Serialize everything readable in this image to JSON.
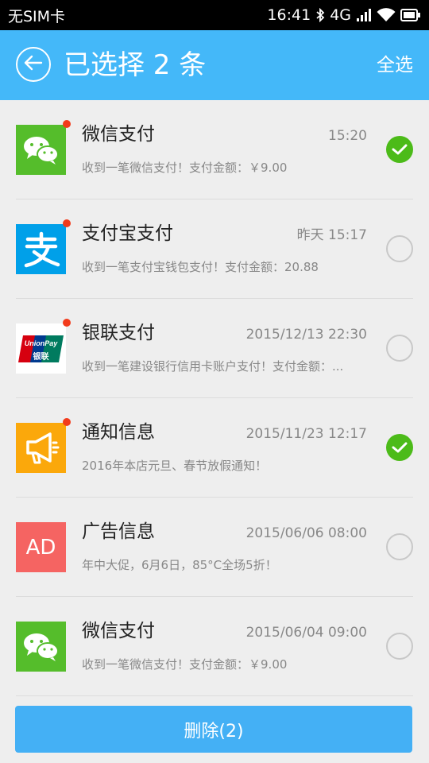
{
  "status_bar": {
    "carrier": "无SIM卡",
    "time": "16:41",
    "network": "4G"
  },
  "header": {
    "title": "已选择 2 条",
    "select_all": "全选",
    "color": "#44b8f9"
  },
  "items": [
    {
      "icon": "wechat-icon",
      "title": "微信支付",
      "time": "15:20",
      "preview": "收到一笔微信支付！支付金额：￥9.00",
      "unread": true,
      "selected": true
    },
    {
      "icon": "alipay-icon",
      "title": "支付宝支付",
      "time": "昨天  15:17",
      "preview": "收到一笔支付宝钱包支付！支付金额：20.88",
      "unread": true,
      "selected": false
    },
    {
      "icon": "unionpay-icon",
      "title": "银联支付",
      "time": "2015/12/13  22:30",
      "preview": "收到一笔建设银行信用卡账户支付！支付金额：...",
      "unread": true,
      "selected": false
    },
    {
      "icon": "megaphone-icon",
      "title": "通知信息",
      "time": "2015/11/23  12:17",
      "preview": "2016年本店元旦、春节放假通知！",
      "unread": true,
      "selected": true
    },
    {
      "icon": "ad-icon",
      "icon_text": "AD",
      "title": "广告信息",
      "time": "2015/06/06  08:00",
      "preview": "年中大促，6月6日，85°C全场5折！",
      "unread": false,
      "selected": false
    },
    {
      "icon": "wechat-icon",
      "title": "微信支付",
      "time": "2015/06/04  09:00",
      "preview": "收到一笔微信支付！支付金额：￥9.00",
      "unread": false,
      "selected": false
    }
  ],
  "union_pay": {
    "brand": "UnionPay",
    "cn": "银联"
  },
  "delete_button": {
    "label": "删除(2)"
  },
  "colors": {
    "check_on": "#4cbb19",
    "unread_dot": "#f23b1b",
    "wechat": "#55bd2b",
    "alipay": "#00a0e9",
    "notice": "#fba80b",
    "ad": "#f56462"
  }
}
